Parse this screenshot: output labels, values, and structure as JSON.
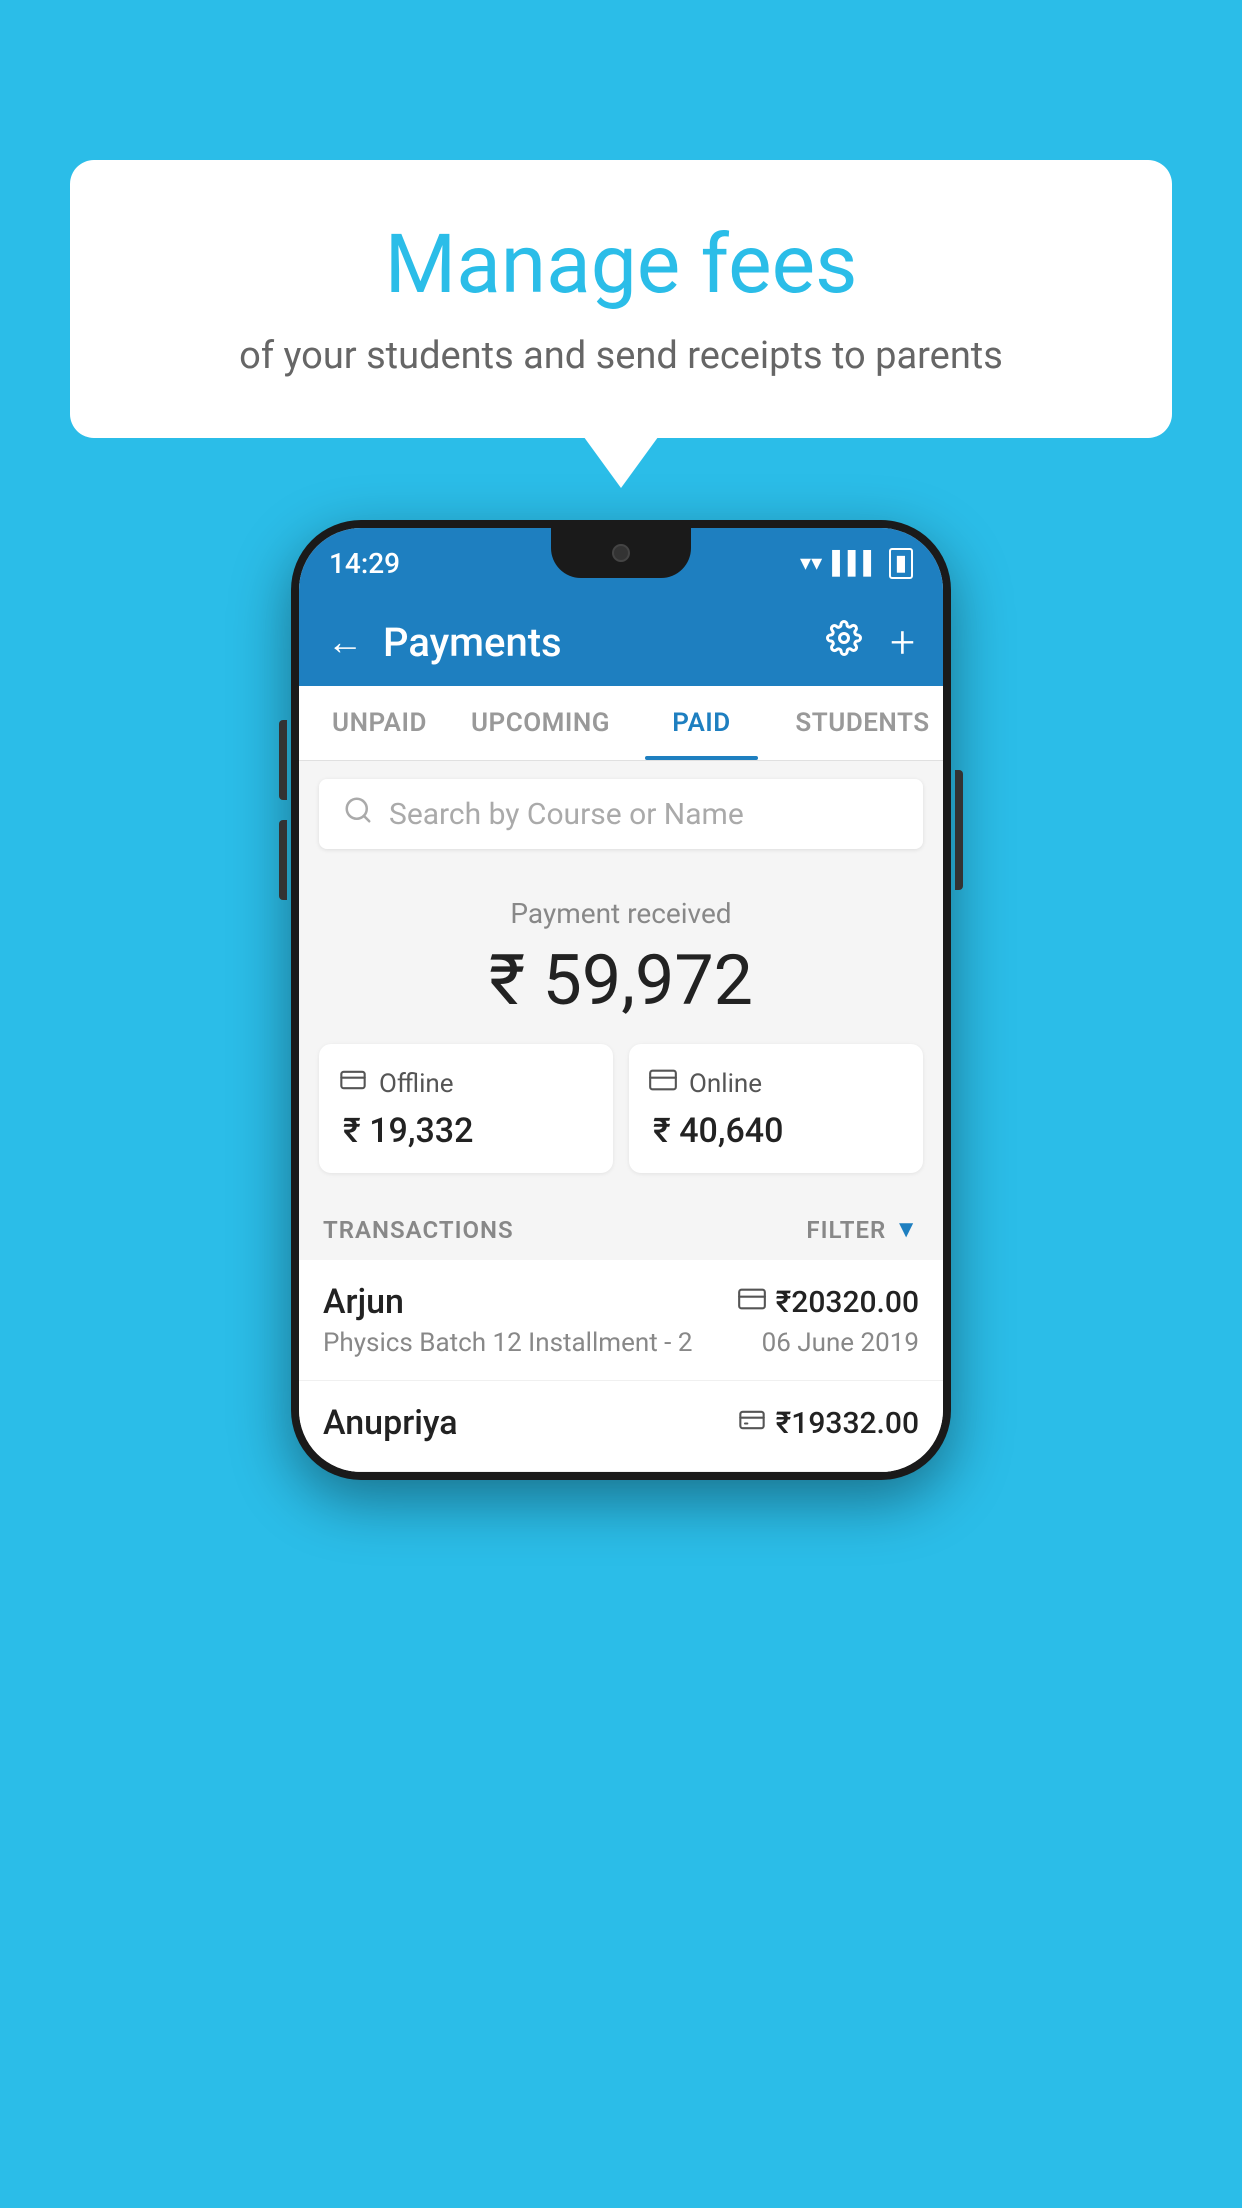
{
  "background_color": "#2BBDE8",
  "speech_bubble": {
    "title": "Manage fees",
    "subtitle": "of your students and send receipts to parents"
  },
  "phone": {
    "status_bar": {
      "time": "14:29",
      "icons": [
        "wifi",
        "signal",
        "battery"
      ]
    },
    "header": {
      "title": "Payments",
      "back_label": "←",
      "settings_icon": "gear",
      "add_icon": "+"
    },
    "tabs": [
      {
        "label": "UNPAID",
        "active": false
      },
      {
        "label": "UPCOMING",
        "active": false
      },
      {
        "label": "PAID",
        "active": true
      },
      {
        "label": "STUDENTS",
        "active": false
      }
    ],
    "search": {
      "placeholder": "Search by Course or Name"
    },
    "payment_summary": {
      "label": "Payment received",
      "total_amount": "₹ 59,972",
      "offline": {
        "type": "Offline",
        "amount": "₹ 19,332",
        "icon": "💳"
      },
      "online": {
        "type": "Online",
        "amount": "₹ 40,640",
        "icon": "💳"
      }
    },
    "transactions": {
      "header_label": "TRANSACTIONS",
      "filter_label": "FILTER",
      "items": [
        {
          "name": "Arjun",
          "course": "Physics Batch 12 Installment - 2",
          "amount": "₹20320.00",
          "date": "06 June 2019",
          "payment_type": "online"
        },
        {
          "name": "Anupriya",
          "course": "",
          "amount": "₹19332.00",
          "date": "",
          "payment_type": "offline"
        }
      ]
    }
  }
}
